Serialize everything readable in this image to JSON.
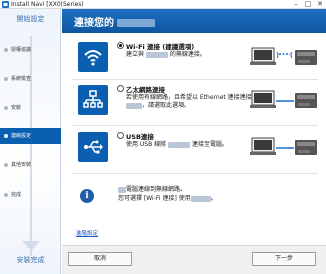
{
  "window": {
    "title": "Install Navi [XX0(Series)",
    "controls": [
      "–",
      "□",
      "✕"
    ]
  },
  "sidebar": {
    "top_heading": "開始設定",
    "bottom_heading": "安裝完成",
    "steps": [
      {
        "label": "授權協議",
        "active": false
      },
      {
        "label": "系統檢查",
        "active": false
      },
      {
        "label": "安裝",
        "active": false
      },
      {
        "label": "連線設定",
        "active": true
      },
      {
        "label": "其他安裝",
        "active": false
      },
      {
        "label": "完成",
        "active": false
      }
    ]
  },
  "header": {
    "title": "連接您的"
  },
  "options": [
    {
      "title": "Wi-Fi 連接 (建議選項)",
      "desc": "建立與",
      "desc_tail": "的無線連接。",
      "selected": true,
      "icon": "wifi-icon"
    },
    {
      "title": "乙太網路連接",
      "desc": "若使用有線網路，且希望以 Ethernet 連接連接",
      "desc_tail": "，請選取此選項。",
      "selected": false,
      "icon": "network-icon"
    },
    {
      "title": "USB連接",
      "desc": "使用 USB 線將",
      "desc_tail": "連接至電腦。",
      "selected": false,
      "icon": "usb-icon"
    }
  ],
  "info": {
    "line1": "電腦連線到無線網路。",
    "line2_prefix": "您可選擇 [Wi-Fi 連接] 使用",
    "line2_suffix": "。"
  },
  "link_text": "進階設定",
  "buttons": {
    "cancel": "取消",
    "next": "下一步"
  },
  "colors": {
    "accent": "#0b5fb0",
    "header": "#1e6fbf",
    "link": "#1a55c4"
  }
}
